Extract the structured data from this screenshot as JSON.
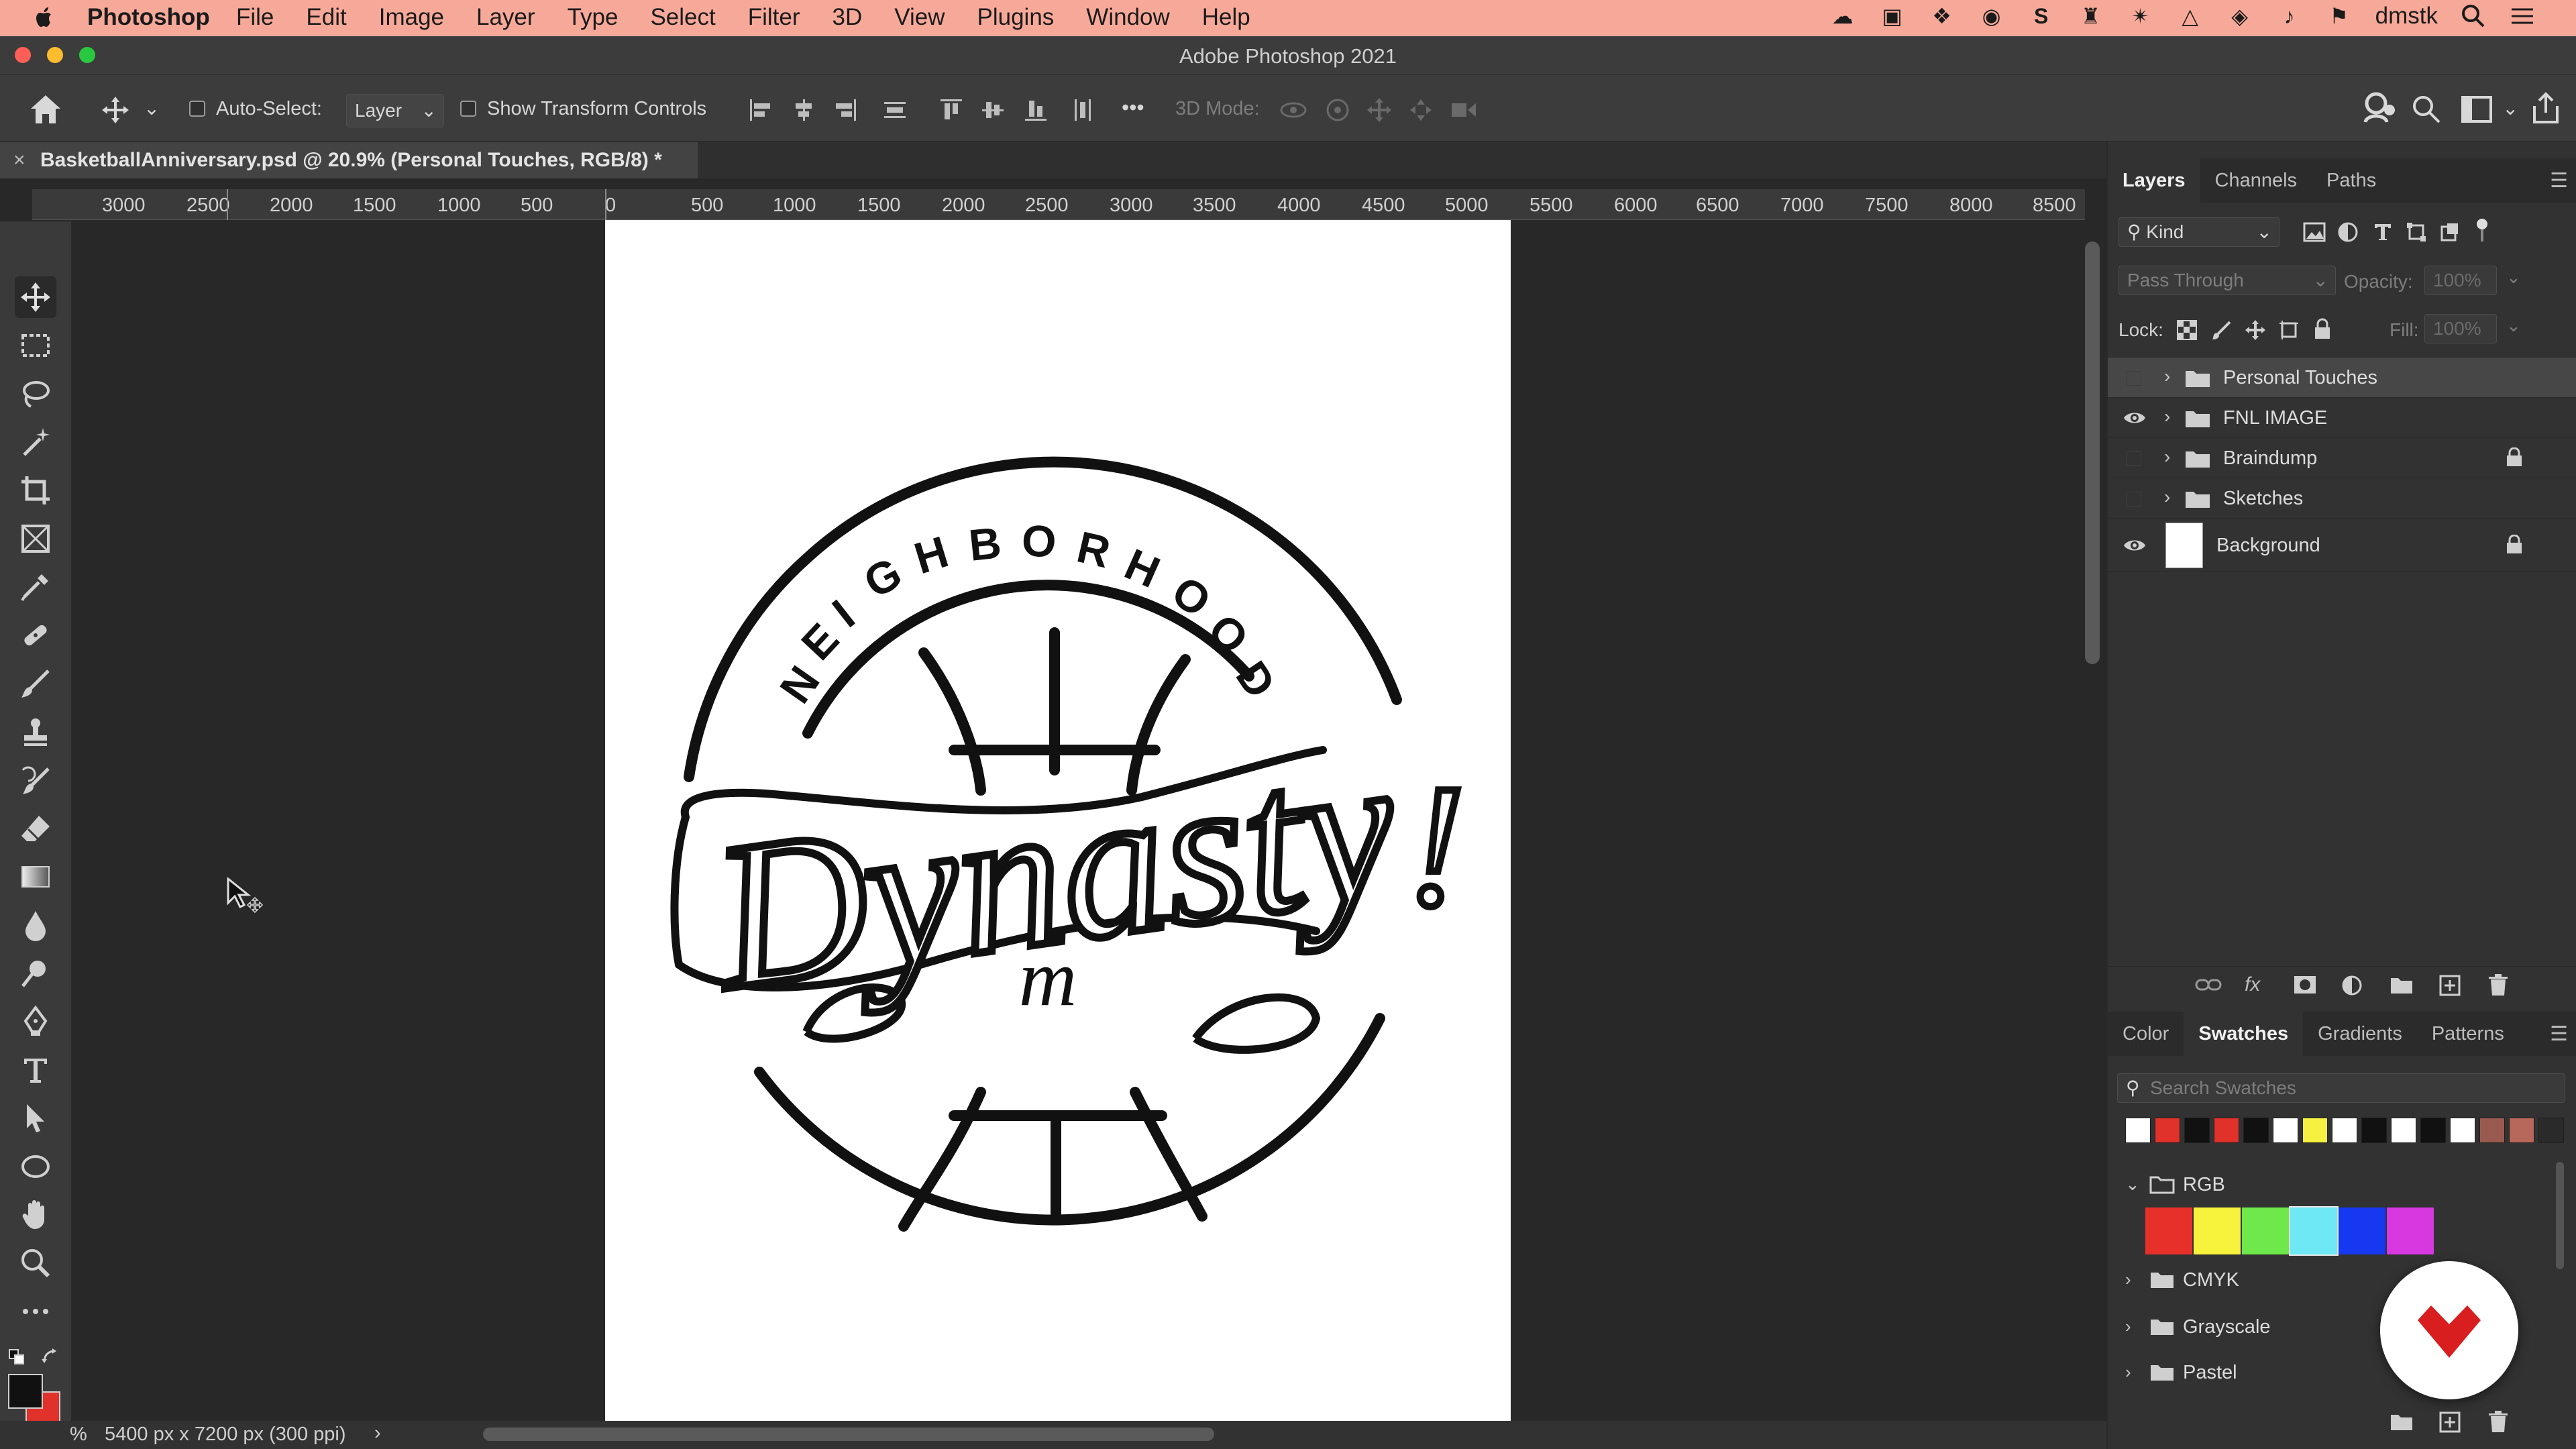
{
  "menubar": {
    "app_name": "Photoshop",
    "items": [
      "File",
      "Edit",
      "Image",
      "Layer",
      "Type",
      "Select",
      "Filter",
      "3D",
      "View",
      "Plugins",
      "Window",
      "Help"
    ],
    "user": "dmstk"
  },
  "window": {
    "title": "Adobe Photoshop 2021"
  },
  "options": {
    "auto_select_label": "Auto-Select:",
    "auto_select_value": "Layer",
    "show_transform_label": "Show Transform Controls",
    "mode_3d_label": "3D Mode:",
    "more": "•••"
  },
  "document": {
    "tab_title": "BasketballAnniversary.psd @ 20.9% (Personal Touches, RGB/8) *",
    "close": "×",
    "status": "5400 px x 7200 px (300 ppi)",
    "zoom_glyph": "%"
  },
  "ruler": {
    "ticks": [
      "3000",
      "2500",
      "2000",
      "1500",
      "1000",
      "500",
      "0",
      "500",
      "1000",
      "1500",
      "2000",
      "2500",
      "3000",
      "3500",
      "4000",
      "4500",
      "5000",
      "5500",
      "6000",
      "6500",
      "7000",
      "7500",
      "8000",
      "8500"
    ]
  },
  "artwork": {
    "arc_text": [
      "N",
      "E",
      "I",
      "G",
      "H",
      "B",
      "O",
      "R",
      "H",
      "O",
      "O",
      "D"
    ],
    "script_text": "Dynasty",
    "exclaim": "!",
    "small_script": "m"
  },
  "layers_panel": {
    "tabs": [
      "Layers",
      "Channels",
      "Paths"
    ],
    "filter_label": "Kind",
    "blend_mode": "Pass Through",
    "opacity_label": "Opacity:",
    "opacity_value": "100%",
    "lock_label": "Lock:",
    "fill_label": "Fill:",
    "fill_value": "100%",
    "layers": [
      {
        "name": "Personal Touches",
        "visible": false,
        "locked": false,
        "selected": true
      },
      {
        "name": "FNL IMAGE",
        "visible": true,
        "locked": false,
        "selected": false
      },
      {
        "name": "Braindump",
        "visible": false,
        "locked": true,
        "selected": false
      },
      {
        "name": "Sketches",
        "visible": false,
        "locked": false,
        "selected": false
      },
      {
        "name": "Background",
        "visible": true,
        "locked": true,
        "selected": false
      }
    ],
    "footer_fx": "fx"
  },
  "swatches_panel": {
    "tabs": [
      "Color",
      "Swatches",
      "Gradients",
      "Patterns"
    ],
    "search_placeholder": "Search Swatches",
    "recent": [
      "#ffffff",
      "#e0322a",
      "#111111",
      "#e0322a",
      "#111111",
      "#ffffff",
      "#f6f040",
      "#ffffff",
      "#111111",
      "#ffffff",
      "#111111",
      "#ffffff",
      "#9a5a50",
      "#b8685a",
      "#2a2a2a"
    ],
    "groups": [
      {
        "name": "RGB",
        "expanded": true,
        "colors": [
          "#e8302a",
          "#f7f23c",
          "#6ee84a",
          "#6fe8f5",
          "#1538f0",
          "#d838e0"
        ]
      },
      {
        "name": "CMYK",
        "expanded": false
      },
      {
        "name": "Grayscale",
        "expanded": false
      },
      {
        "name": "Pastel",
        "expanded": false
      }
    ]
  },
  "colors": {
    "menubar_bg": "#f7a999",
    "foreground": "#111111",
    "background": "#e0322a",
    "badge_red": "#d81e1e"
  },
  "icons": [
    "apple-icon",
    "home-icon",
    "move-icon",
    "search-icon",
    "eye-icon",
    "folder-icon",
    "lock-icon",
    "trash-icon"
  ]
}
